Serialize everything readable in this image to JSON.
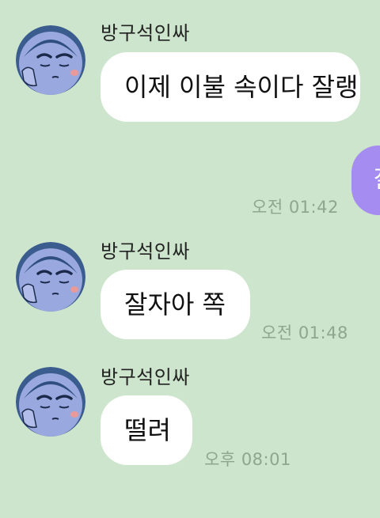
{
  "messages": [
    {
      "sender": "방구석인싸",
      "text": "이제 이불 속이다 잘랭",
      "side": "left"
    },
    {
      "text": "잘",
      "time": "오전 01:42",
      "side": "right"
    },
    {
      "sender": "방구석인싸",
      "text": "잘자아 쪽",
      "time": "오전 01:48",
      "side": "left"
    },
    {
      "sender": "방구석인싸",
      "text": "떨려",
      "time": "오후 08:01",
      "side": "left"
    }
  ],
  "colors": {
    "background": "#cde5cc",
    "incoming_bubble": "#ffffff",
    "outgoing_bubble": "#a58cf0",
    "timestamp": "#8fa58d"
  },
  "icons": {
    "avatar": "sleepy-face-avatar-icon"
  }
}
